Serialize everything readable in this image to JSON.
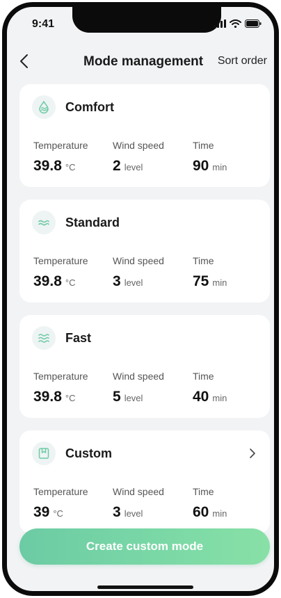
{
  "status_bar": {
    "time": "9:41",
    "icons": [
      "signal-icon",
      "wifi-icon",
      "battery-icon"
    ]
  },
  "nav": {
    "back_icon": "chevron-left-icon",
    "title": "Mode management",
    "action": "Sort order"
  },
  "modes": [
    {
      "name": "Comfort",
      "icon": "comfort-wave-drop-icon",
      "temperature": {
        "label": "Temperature",
        "value": "39.8",
        "unit": "°C"
      },
      "wind": {
        "label": "Wind speed",
        "value": "2",
        "unit": "level"
      },
      "time": {
        "label": "Time",
        "value": "90",
        "unit": "min"
      }
    },
    {
      "name": "Standard",
      "icon": "standard-wave-icon",
      "temperature": {
        "label": "Temperature",
        "value": "39.8",
        "unit": "°C"
      },
      "wind": {
        "label": "Wind speed",
        "value": "3",
        "unit": "level"
      },
      "time": {
        "label": "Time",
        "value": "75",
        "unit": "min"
      }
    },
    {
      "name": "Fast",
      "icon": "fast-triple-wave-icon",
      "temperature": {
        "label": "Temperature",
        "value": "39.8",
        "unit": "°C"
      },
      "wind": {
        "label": "Wind speed",
        "value": "5",
        "unit": "level"
      },
      "time": {
        "label": "Time",
        "value": "40",
        "unit": "min"
      }
    },
    {
      "name": "Custom",
      "icon": "custom-bookmark-icon",
      "has_chevron": true,
      "temperature": {
        "label": "Temperature",
        "value": "39",
        "unit": "°C"
      },
      "wind": {
        "label": "Wind speed",
        "value": "3",
        "unit": "level"
      },
      "time": {
        "label": "Time",
        "value": "60",
        "unit": "min"
      }
    }
  ],
  "create_button": {
    "label": "Create custom mode"
  },
  "colors": {
    "accent_green": "#6ccba4",
    "icon_bg": "#eef3f4",
    "page_bg": "#f2f3f5"
  }
}
